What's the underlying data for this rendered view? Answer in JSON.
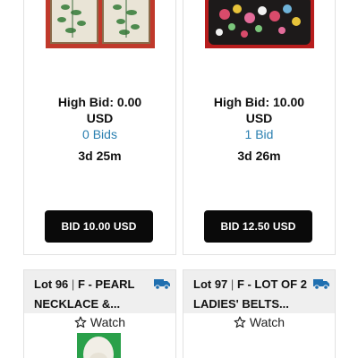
{
  "lots": [
    {
      "high_bid": "High Bid: 0.00",
      "currency": "USD",
      "bids": "0 Bids",
      "time_left": "3d 25m",
      "bid_button": "BID 10.00 USD"
    },
    {
      "high_bid": "High Bid: 10.00",
      "currency": "USD",
      "bids": "1 Bid",
      "time_left": "3d 26m",
      "bid_button": "BID 12.50 USD"
    },
    {
      "lot_label": "Lot 96",
      "separator": "|",
      "title": "F - PEARL NECKLACE &...",
      "watch": "Watch",
      "shipping_icon": "truck-icon"
    },
    {
      "lot_label": "Lot 97",
      "separator": "|",
      "title": "F - LOT OF 2 LADIES' BELTS...",
      "watch": "Watch",
      "shipping_icon": "truck-icon"
    }
  ],
  "colors": {
    "accent_link": "#2a7fb0",
    "button_bg": "#0a0a0a",
    "truck": "#1f6fb0"
  }
}
